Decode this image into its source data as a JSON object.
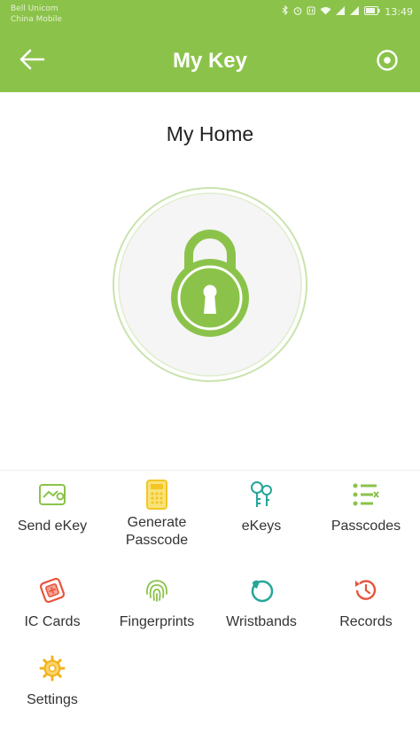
{
  "status_bar": {
    "carrier_1": "Bell Unicom",
    "carrier_2": "China Mobile",
    "time": "13:49",
    "icons": [
      "bluetooth-icon",
      "alarm-icon",
      "nfc-icon",
      "wifi-icon",
      "signal-icon",
      "signal-icon",
      "battery-icon"
    ]
  },
  "header": {
    "title": "My Key",
    "back_icon": "back-arrow-icon",
    "settings_icon": "lock-settings-icon"
  },
  "lock": {
    "name": "My Home",
    "icon": "padlock-icon",
    "accent_color": "#8bc34a"
  },
  "menu": {
    "items": [
      {
        "label": "Send eKey",
        "icon": "send-ekey-icon",
        "color": "#8bc34a"
      },
      {
        "label": "Generate\nPasscode",
        "icon": "generate-passcode-icon",
        "color": "#f3c623"
      },
      {
        "label": "eKeys",
        "icon": "ekeys-icon",
        "color": "#26a69a"
      },
      {
        "label": "Passcodes",
        "icon": "passcodes-icon",
        "color": "#8bc34a"
      },
      {
        "label": "IC Cards",
        "icon": "ic-cards-icon",
        "color": "#e8543c"
      },
      {
        "label": "Fingerprints",
        "icon": "fingerprint-icon",
        "color": "#8bc34a"
      },
      {
        "label": "Wristbands",
        "icon": "wristband-icon",
        "color": "#26a69a"
      },
      {
        "label": "Records",
        "icon": "records-icon",
        "color": "#e8543c"
      },
      {
        "label": "Settings",
        "icon": "gear-icon",
        "color": "#f3b21b"
      }
    ]
  }
}
